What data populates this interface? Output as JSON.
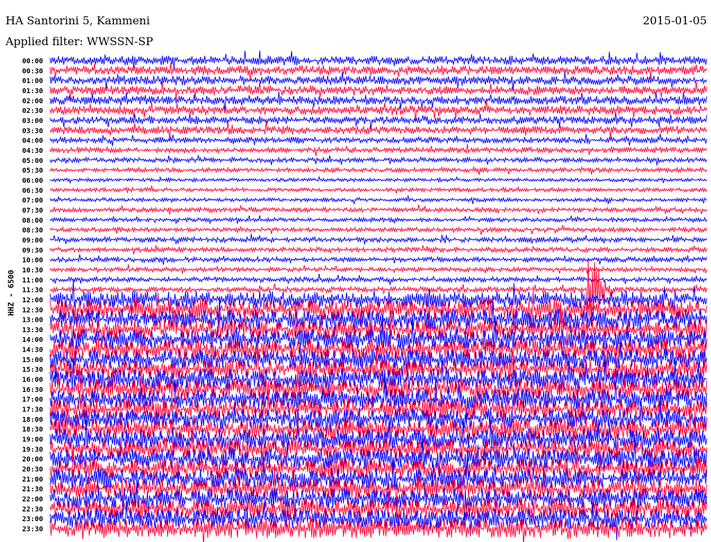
{
  "header": {
    "station": "HA Santorini 5, Kammeni",
    "date": "2015-01-05",
    "filter": "Applied filter: WWSSN-SP"
  },
  "chart_data": {
    "type": "line",
    "title": "HA Santorini 5, Kammeni",
    "ylabel": "HHZ - 6500",
    "row_minutes": 30,
    "colors": [
      "#0000ff",
      "#ff0033"
    ],
    "rows": [
      "00:00",
      "00:30",
      "01:00",
      "01:30",
      "02:00",
      "02:30",
      "03:00",
      "03:30",
      "04:00",
      "04:30",
      "05:00",
      "05:30",
      "06:00",
      "06:30",
      "07:00",
      "07:30",
      "08:00",
      "08:30",
      "09:00",
      "09:30",
      "10:00",
      "10:30",
      "11:00",
      "11:30",
      "12:00",
      "12:30",
      "13:00",
      "13:30",
      "14:00",
      "14:30",
      "15:00",
      "15:30",
      "16:00",
      "16:30",
      "17:00",
      "17:30",
      "18:00",
      "18:30",
      "19:00",
      "19:30",
      "20:00",
      "20:30",
      "21:00",
      "21:30",
      "22:00",
      "22:30",
      "23:00",
      "23:30"
    ],
    "relative_amplitude": [
      0.9,
      0.9,
      0.9,
      0.9,
      0.9,
      0.9,
      0.8,
      0.8,
      0.6,
      0.55,
      0.5,
      0.45,
      0.35,
      0.4,
      0.4,
      0.45,
      0.4,
      0.45,
      0.5,
      0.5,
      0.5,
      0.45,
      0.5,
      0.55,
      1.6,
      2.0,
      2.0,
      2.0,
      2.0,
      2.0,
      2.0,
      2.0,
      2.0,
      2.0,
      2.0,
      2.0,
      2.0,
      2.0,
      2.0,
      2.0,
      2.0,
      2.0,
      2.0,
      2.0,
      2.0,
      2.0,
      2.0,
      2.0
    ],
    "event": {
      "row": "11:30",
      "minute": 24.5,
      "relative_amplitude": 14
    }
  }
}
